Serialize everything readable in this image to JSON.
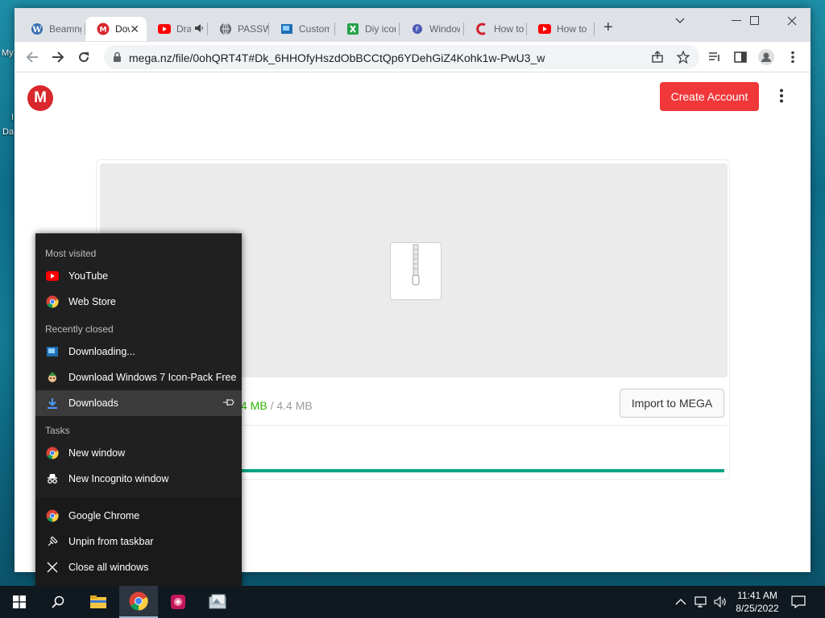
{
  "desktop": {
    "labels": [
      "My",
      "I",
      "Da"
    ]
  },
  "browser": {
    "tabs": [
      {
        "label": "Beamng",
        "icon": "wordpress-icon"
      },
      {
        "label": "Download",
        "icon": "mega-icon",
        "active": true
      },
      {
        "label": "Drama",
        "icon": "youtube-icon",
        "audio": true
      },
      {
        "label": "PASSWORD",
        "icon": "globe-icon"
      },
      {
        "label": "Customize",
        "icon": "photo-icon"
      },
      {
        "label": "Diy icon",
        "icon": "green-doc-icon"
      },
      {
        "label": "Windows",
        "icon": "f-circle-icon"
      },
      {
        "label": "How to",
        "icon": "c-logo-icon"
      },
      {
        "label": "How to",
        "icon": "youtube-icon"
      }
    ],
    "url": "mega.nz/file/0ohQRT4T#Dk_6HHOfyHszdObBCCtQp6YDehGiZ4Kohk1w-PwU3_w"
  },
  "page": {
    "logo": "M",
    "create_account": "Create Account",
    "size_done": "4 MB",
    "size_sep": "/",
    "size_total": "4.4 MB",
    "import_label": "Import to MEGA",
    "progress": 1.0
  },
  "jumplist": {
    "most_visited_header": "Most visited",
    "most_visited": [
      {
        "label": "YouTube",
        "icon": "youtube-icon"
      },
      {
        "label": "Web Store",
        "icon": "chrome-icon"
      }
    ],
    "recently_closed_header": "Recently closed",
    "recently_closed": [
      {
        "label": "Downloading...",
        "icon": "photo-icon"
      },
      {
        "label": "Download Windows 7 Icon-Pack Free",
        "icon": "elf-icon"
      },
      {
        "label": "Downloads",
        "icon": "download-icon"
      }
    ],
    "tasks_header": "Tasks",
    "tasks": [
      {
        "label": "New window",
        "icon": "chrome-icon"
      },
      {
        "label": "New Incognito window",
        "icon": "incognito-icon"
      }
    ],
    "app": [
      {
        "label": "Google Chrome",
        "icon": "chrome-icon"
      },
      {
        "label": "Unpin from taskbar",
        "icon": "unpin-icon"
      },
      {
        "label": "Close all windows",
        "icon": "close-icon"
      }
    ]
  },
  "taskbar": {
    "time": "11:41 AM",
    "date": "8/25/2022"
  }
}
